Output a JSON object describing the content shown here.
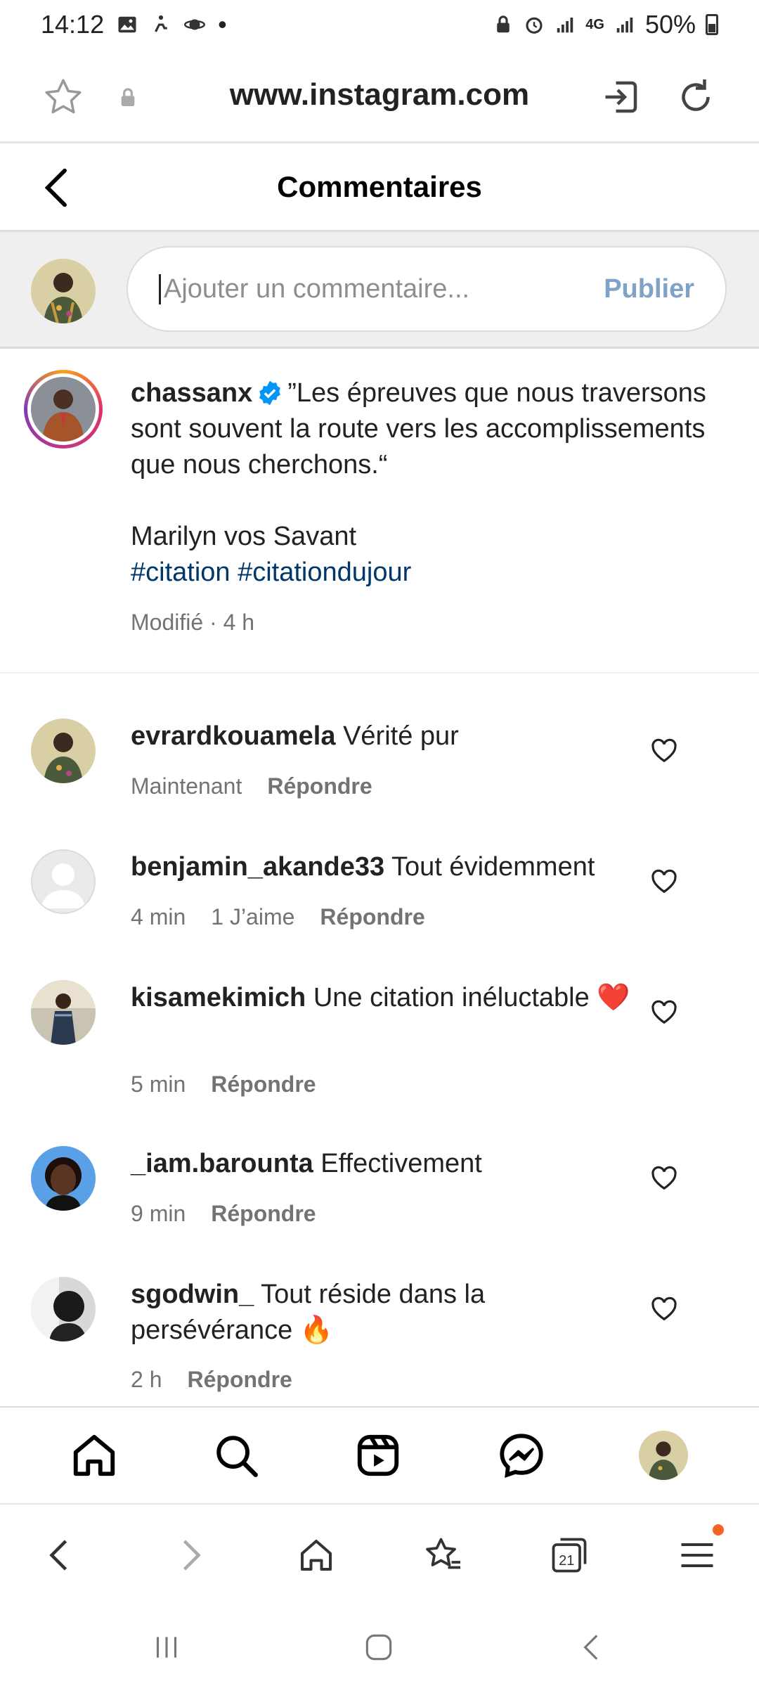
{
  "status_bar": {
    "time": "14:12",
    "battery": "50%",
    "network": "4G"
  },
  "browser": {
    "url": "www.instagram.com"
  },
  "header": {
    "title": "Commentaires"
  },
  "composer": {
    "placeholder": "Ajouter un commentaire...",
    "publish_label": "Publier"
  },
  "caption": {
    "username": "chassanx",
    "verified": true,
    "quote": "”Les épreuves que nous traversons sont souvent la route vers les accomplissements que nous cherchons.“",
    "author": "Marilyn vos Savant",
    "hashtags": [
      "#citation",
      "#citationdujour"
    ],
    "meta": "Modifié · 4 h"
  },
  "comments": [
    {
      "username": "evrardkouamela",
      "text": "Vérité pur",
      "time": "Maintenant",
      "likes": "",
      "reply_label": "Répondre"
    },
    {
      "username": "benjamin_akande33",
      "text": "Tout évidemment",
      "time": "4 min",
      "likes": "1 J’aime",
      "reply_label": "Répondre"
    },
    {
      "username": "kisamekimich",
      "text": "Une citation inéluctable ❤️",
      "time": "5 min",
      "likes": "",
      "reply_label": "Répondre"
    },
    {
      "username": "_iam.barounta",
      "text": "Effectivement",
      "time": "9 min",
      "likes": "",
      "reply_label": "Répondre"
    },
    {
      "username": "sgodwin_",
      "text": "Tout réside dans la persévérance 🔥",
      "time": "2 h",
      "likes": "",
      "reply_label": "Répondre"
    }
  ],
  "ig_nav": {
    "items": [
      "home-icon",
      "search-icon",
      "reels-icon",
      "messenger-icon",
      "profile-avatar"
    ]
  },
  "browser_nav": {
    "tabs_count": "21",
    "items": [
      "back-icon",
      "forward-icon",
      "home-icon",
      "bookmarks-icon",
      "tabs-icon",
      "menu-icon"
    ]
  },
  "colors": {
    "link": "#00376b",
    "verified": "#0095f6",
    "publish": "#7fa3c6",
    "notification_dot": "#f26522"
  }
}
